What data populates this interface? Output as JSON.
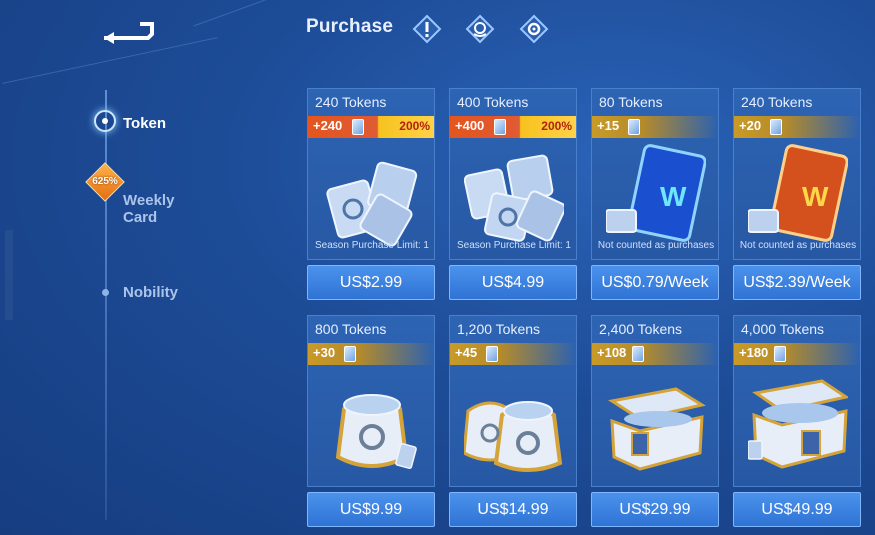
{
  "header": {
    "title": "Purchase",
    "icons": [
      "info-icon",
      "support-icon",
      "settings-icon"
    ]
  },
  "nav": {
    "items": [
      {
        "label": "Token",
        "active": true
      },
      {
        "label": "Weekly Card",
        "badge": "625%"
      },
      {
        "label": "Nobility"
      }
    ]
  },
  "cards": [
    {
      "title": "240 Tokens",
      "bonus": "+240",
      "percent": "200%",
      "note": "Season Purchase Limit: 1",
      "price": "US$2.99"
    },
    {
      "title": "400 Tokens",
      "bonus": "+400",
      "percent": "200%",
      "note": "Season Purchase Limit: 1",
      "price": "US$4.99"
    },
    {
      "title": "80 Tokens",
      "bonus": "+15",
      "note": "Not counted as purchases",
      "price": "US$0.79/Week"
    },
    {
      "title": "240 Tokens",
      "bonus": "+20",
      "note": "Not counted as purchases",
      "price": "US$2.39/Week"
    },
    {
      "title": "800 Tokens",
      "bonus": "+30",
      "price": "US$9.99"
    },
    {
      "title": "1,200 Tokens",
      "bonus": "+45",
      "price": "US$14.99"
    },
    {
      "title": "2,400 Tokens",
      "bonus": "+108",
      "price": "US$29.99"
    },
    {
      "title": "4,000 Tokens",
      "bonus": "+180",
      "price": "US$49.99"
    }
  ],
  "colors": {
    "background": "#1d4c97",
    "card": "#2d64b3",
    "price_button": "#3a80e0",
    "bonus_gold": "#c99a28",
    "bonus_red": "#e4551f",
    "percent_yellow": "#ffd24a"
  }
}
